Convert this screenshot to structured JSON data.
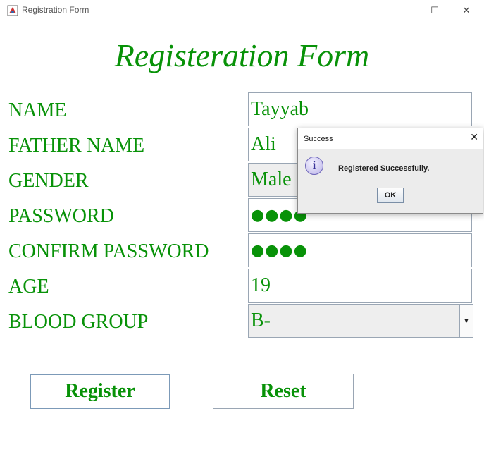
{
  "window": {
    "title": "Registration Form",
    "minimize": "—",
    "maximize": "☐",
    "close": "✕"
  },
  "form": {
    "heading": "Registeration Form",
    "labels": {
      "name": "NAME",
      "father_name": "FATHER NAME",
      "gender": "GENDER",
      "password": "PASSWORD",
      "confirm_password": "CONFIRM PASSWORD",
      "age": "AGE",
      "blood_group": "BLOOD GROUP"
    },
    "values": {
      "name": "Tayyab",
      "father_name": "Ali",
      "gender": "Male",
      "password": "●●●●",
      "confirm_password": "●●●●",
      "age": "19",
      "blood_group": "B-"
    },
    "buttons": {
      "register": "Register",
      "reset": "Reset"
    },
    "colors": {
      "text": "#089208"
    }
  },
  "dialog": {
    "title": "Success",
    "close": "✕",
    "icon": "info-icon",
    "icon_glyph": "i",
    "message": "Registered Successfully.",
    "ok": "OK"
  }
}
